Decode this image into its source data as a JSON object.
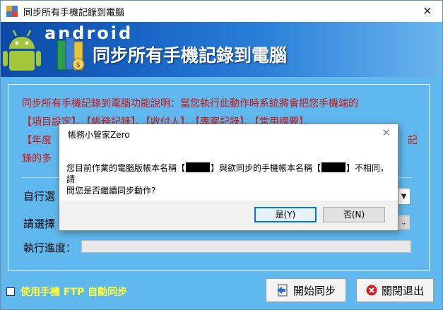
{
  "window": {
    "title": "同步所有手機記錄到電腦"
  },
  "banner": {
    "android_text": "android",
    "title": "同步所有手機記錄到電腦"
  },
  "description": {
    "lines": [
      "同步所有手機記錄到電腦功能說明：當您執行此動作時系統將會把您手機端的",
      "【項目設定】、【帳務記錄】、【收付人】、【專案記錄】、【常用摘要】、",
      "【年度",
      "錄的多"
    ],
    "line3_tail": "記"
  },
  "form": {
    "select_label_1": "自行選",
    "select_label_2": "請選擇",
    "progress_label": "執行進度：",
    "progress_value": 0
  },
  "footer": {
    "ftp_checkbox_label": "使用手機 FTP 自動同步",
    "ftp_checked": false,
    "start_button": "開始同步",
    "exit_button": "關閉退出"
  },
  "dialog": {
    "title": "帳務小管家Zero",
    "msg_part1": "您目前作業的電腦版帳本名稱【",
    "msg_part2": "】與欲同步的手機帳本名稱【",
    "msg_part3": "】不相同，請",
    "msg_line2": "問您是否繼續同步動作?",
    "yes_button": "是(Y)",
    "no_button": "否(N)"
  },
  "colors": {
    "window_bg": "#60b9ee",
    "description_text": "#d01010",
    "ftp_label": "#ffff33",
    "dialog_default_border": "#0078d7"
  }
}
